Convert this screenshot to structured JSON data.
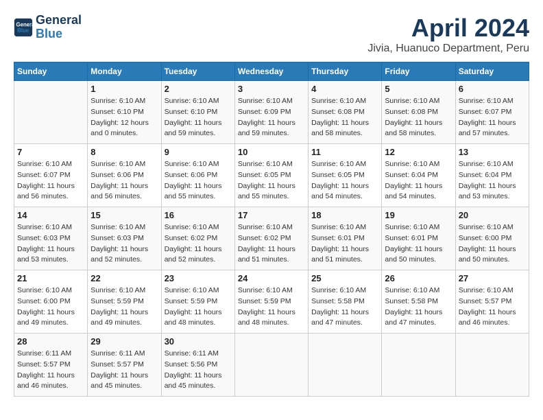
{
  "header": {
    "logo_general": "General",
    "logo_blue": "Blue",
    "title": "April 2024",
    "subtitle": "Jivia, Huanuco Department, Peru"
  },
  "calendar": {
    "weekdays": [
      "Sunday",
      "Monday",
      "Tuesday",
      "Wednesday",
      "Thursday",
      "Friday",
      "Saturday"
    ],
    "weeks": [
      [
        {
          "day": "",
          "info": ""
        },
        {
          "day": "1",
          "info": "Sunrise: 6:10 AM\nSunset: 6:10 PM\nDaylight: 12 hours\nand 0 minutes."
        },
        {
          "day": "2",
          "info": "Sunrise: 6:10 AM\nSunset: 6:10 PM\nDaylight: 11 hours\nand 59 minutes."
        },
        {
          "day": "3",
          "info": "Sunrise: 6:10 AM\nSunset: 6:09 PM\nDaylight: 11 hours\nand 59 minutes."
        },
        {
          "day": "4",
          "info": "Sunrise: 6:10 AM\nSunset: 6:08 PM\nDaylight: 11 hours\nand 58 minutes."
        },
        {
          "day": "5",
          "info": "Sunrise: 6:10 AM\nSunset: 6:08 PM\nDaylight: 11 hours\nand 58 minutes."
        },
        {
          "day": "6",
          "info": "Sunrise: 6:10 AM\nSunset: 6:07 PM\nDaylight: 11 hours\nand 57 minutes."
        }
      ],
      [
        {
          "day": "7",
          "info": "Sunrise: 6:10 AM\nSunset: 6:07 PM\nDaylight: 11 hours\nand 56 minutes."
        },
        {
          "day": "8",
          "info": "Sunrise: 6:10 AM\nSunset: 6:06 PM\nDaylight: 11 hours\nand 56 minutes."
        },
        {
          "day": "9",
          "info": "Sunrise: 6:10 AM\nSunset: 6:06 PM\nDaylight: 11 hours\nand 55 minutes."
        },
        {
          "day": "10",
          "info": "Sunrise: 6:10 AM\nSunset: 6:05 PM\nDaylight: 11 hours\nand 55 minutes."
        },
        {
          "day": "11",
          "info": "Sunrise: 6:10 AM\nSunset: 6:05 PM\nDaylight: 11 hours\nand 54 minutes."
        },
        {
          "day": "12",
          "info": "Sunrise: 6:10 AM\nSunset: 6:04 PM\nDaylight: 11 hours\nand 54 minutes."
        },
        {
          "day": "13",
          "info": "Sunrise: 6:10 AM\nSunset: 6:04 PM\nDaylight: 11 hours\nand 53 minutes."
        }
      ],
      [
        {
          "day": "14",
          "info": "Sunrise: 6:10 AM\nSunset: 6:03 PM\nDaylight: 11 hours\nand 53 minutes."
        },
        {
          "day": "15",
          "info": "Sunrise: 6:10 AM\nSunset: 6:03 PM\nDaylight: 11 hours\nand 52 minutes."
        },
        {
          "day": "16",
          "info": "Sunrise: 6:10 AM\nSunset: 6:02 PM\nDaylight: 11 hours\nand 52 minutes."
        },
        {
          "day": "17",
          "info": "Sunrise: 6:10 AM\nSunset: 6:02 PM\nDaylight: 11 hours\nand 51 minutes."
        },
        {
          "day": "18",
          "info": "Sunrise: 6:10 AM\nSunset: 6:01 PM\nDaylight: 11 hours\nand 51 minutes."
        },
        {
          "day": "19",
          "info": "Sunrise: 6:10 AM\nSunset: 6:01 PM\nDaylight: 11 hours\nand 50 minutes."
        },
        {
          "day": "20",
          "info": "Sunrise: 6:10 AM\nSunset: 6:00 PM\nDaylight: 11 hours\nand 50 minutes."
        }
      ],
      [
        {
          "day": "21",
          "info": "Sunrise: 6:10 AM\nSunset: 6:00 PM\nDaylight: 11 hours\nand 49 minutes."
        },
        {
          "day": "22",
          "info": "Sunrise: 6:10 AM\nSunset: 5:59 PM\nDaylight: 11 hours\nand 49 minutes."
        },
        {
          "day": "23",
          "info": "Sunrise: 6:10 AM\nSunset: 5:59 PM\nDaylight: 11 hours\nand 48 minutes."
        },
        {
          "day": "24",
          "info": "Sunrise: 6:10 AM\nSunset: 5:59 PM\nDaylight: 11 hours\nand 48 minutes."
        },
        {
          "day": "25",
          "info": "Sunrise: 6:10 AM\nSunset: 5:58 PM\nDaylight: 11 hours\nand 47 minutes."
        },
        {
          "day": "26",
          "info": "Sunrise: 6:10 AM\nSunset: 5:58 PM\nDaylight: 11 hours\nand 47 minutes."
        },
        {
          "day": "27",
          "info": "Sunrise: 6:10 AM\nSunset: 5:57 PM\nDaylight: 11 hours\nand 46 minutes."
        }
      ],
      [
        {
          "day": "28",
          "info": "Sunrise: 6:11 AM\nSunset: 5:57 PM\nDaylight: 11 hours\nand 46 minutes."
        },
        {
          "day": "29",
          "info": "Sunrise: 6:11 AM\nSunset: 5:57 PM\nDaylight: 11 hours\nand 45 minutes."
        },
        {
          "day": "30",
          "info": "Sunrise: 6:11 AM\nSunset: 5:56 PM\nDaylight: 11 hours\nand 45 minutes."
        },
        {
          "day": "",
          "info": ""
        },
        {
          "day": "",
          "info": ""
        },
        {
          "day": "",
          "info": ""
        },
        {
          "day": "",
          "info": ""
        }
      ]
    ]
  }
}
